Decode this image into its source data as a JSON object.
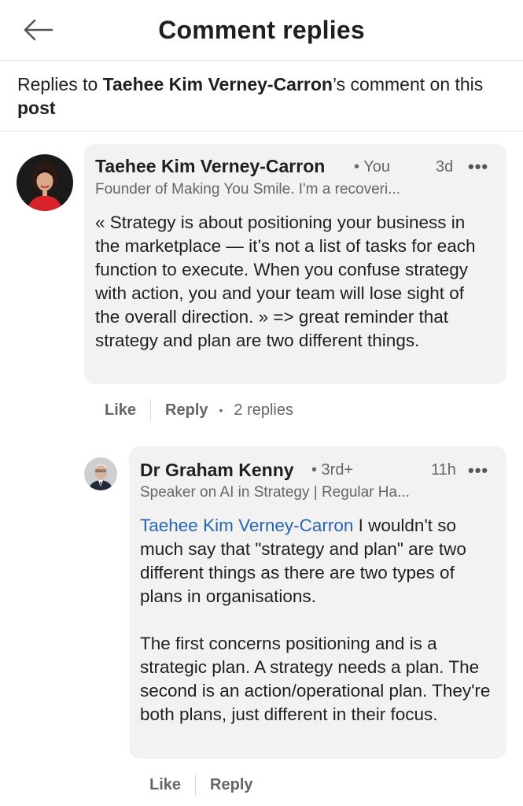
{
  "header": {
    "title": "Comment replies",
    "back_icon": "arrow-left-icon"
  },
  "context": {
    "prefix": "Replies to ",
    "author": "Taehee Kim Verney-Carron",
    "middle": "’s comment on this ",
    "target": "post"
  },
  "comments": [
    {
      "name": "Taehee Kim Verney-Carron",
      "degree": "• You",
      "time": "3d",
      "headline": "Founder of Making You Smile. I'm a recoveri...",
      "text": "« Strategy is about positioning your business in the marketplace — it’s not a list of tasks for each function to execute. When you confuse strategy with action, you and your team will lose sight of the overall direction. » => great reminder that strategy and plan are two different things.",
      "actions": {
        "like": "Like",
        "reply": "Reply",
        "replies": "2 replies"
      }
    },
    {
      "name": "Dr Graham Kenny",
      "degree": "• 3rd+",
      "time": "11h",
      "headline": "Speaker on AI in Strategy | Regular Ha...",
      "mention": "Taehee Kim Verney-Carron",
      "text1": " I wouldn't so much say that \"strategy and plan\" are two different things as there are two types of plans in organisations.",
      "text2": "The first concerns positioning and is a strategic plan. A strategy needs a plan. The second is an action/operational plan. They're both plans, just different in their focus.",
      "actions": {
        "like": "Like",
        "reply": "Reply"
      }
    }
  ],
  "more_icon": "•••",
  "colors": {
    "mention": "#2865b0",
    "bubble": "#f2f2f2",
    "divider": "#e3e3e3"
  }
}
